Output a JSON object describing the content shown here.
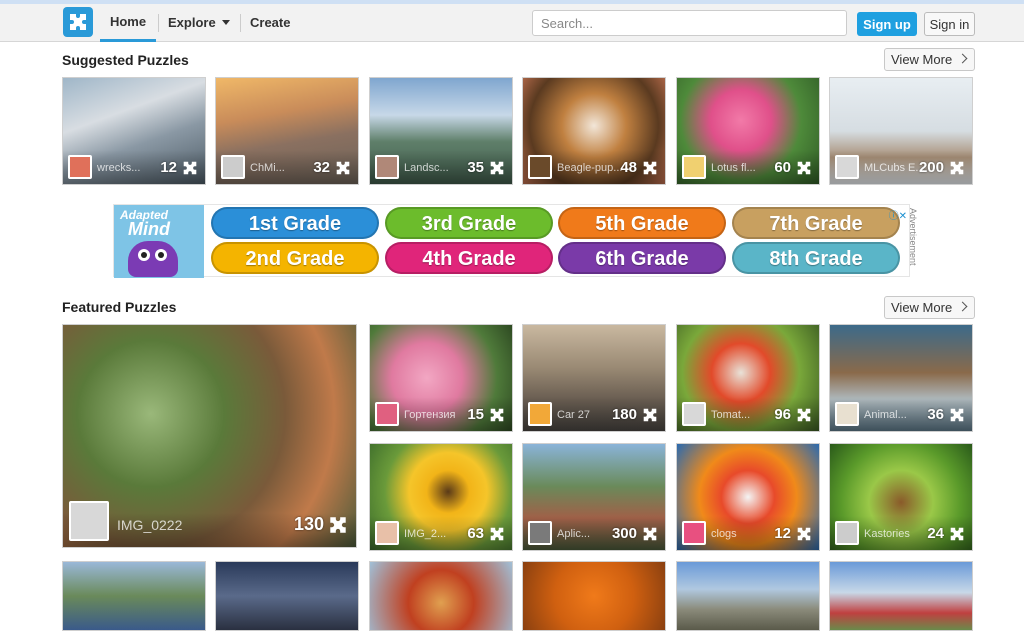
{
  "nav": {
    "home": "Home",
    "explore": "Explore",
    "create": "Create",
    "search_placeholder": "Search...",
    "signup": "Sign up",
    "signin": "Sign in"
  },
  "suggested": {
    "title": "Suggested Puzzles",
    "view_more": "View More",
    "items": [
      {
        "name": "wrecks...",
        "pieces": "12"
      },
      {
        "name": "ChMi...",
        "pieces": "32"
      },
      {
        "name": "Landsc...",
        "pieces": "35"
      },
      {
        "name": "Beagle-pup...",
        "pieces": "48"
      },
      {
        "name": "Lotus fl...",
        "pieces": "60"
      },
      {
        "name": "MLCubs E...",
        "pieces": "200"
      }
    ]
  },
  "ad": {
    "brand_line1": "Adapted",
    "brand_line2": "Mind",
    "label": "Advertisement",
    "grades": [
      "1st Grade",
      "3rd Grade",
      "5th Grade",
      "7th Grade",
      "2nd Grade",
      "4th Grade",
      "6th Grade",
      "8th Grade"
    ],
    "colors": [
      "#2b8fd8",
      "#6cbc2c",
      "#f07a1a",
      "#c8a060",
      "#f4b400",
      "#e0257a",
      "#7a3aa8",
      "#5ab5c8"
    ]
  },
  "featured": {
    "title": "Featured Puzzles",
    "view_more": "View More",
    "big": {
      "name": "IMG_0222",
      "pieces": "130"
    },
    "items": [
      {
        "name": "Гортензия",
        "pieces": "15"
      },
      {
        "name": "Car 27",
        "pieces": "180"
      },
      {
        "name": "Tomat...",
        "pieces": "96"
      },
      {
        "name": "Animal...",
        "pieces": "36"
      },
      {
        "name": "IMG_2...",
        "pieces": "63"
      },
      {
        "name": "Aplic...",
        "pieces": "300"
      },
      {
        "name": "clogs",
        "pieces": "12"
      },
      {
        "name": "Kastories",
        "pieces": "24"
      }
    ]
  }
}
